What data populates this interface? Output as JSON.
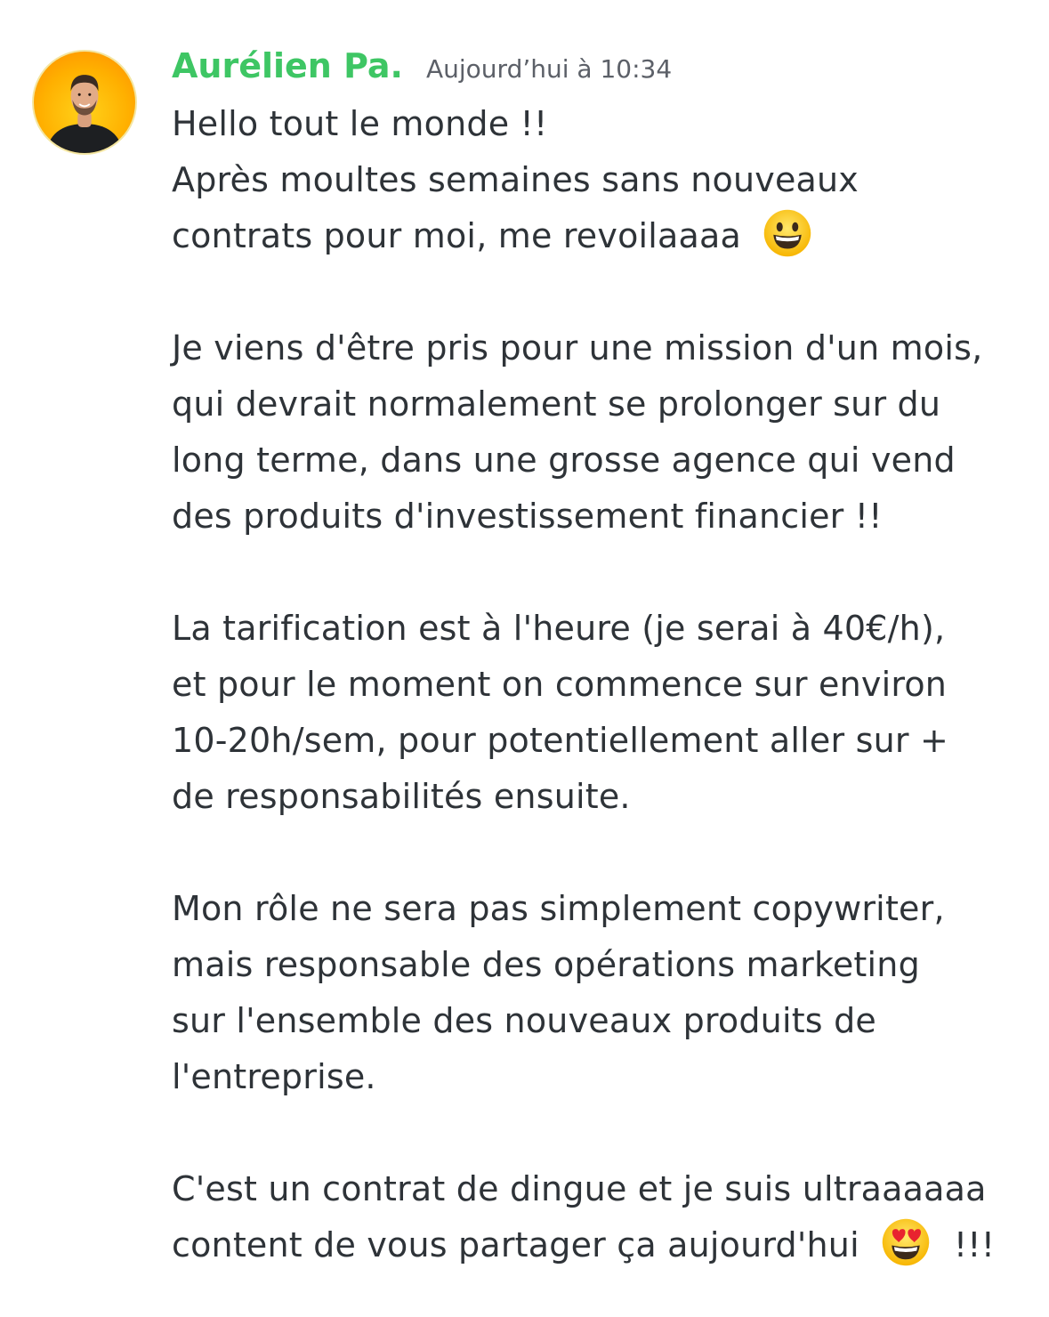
{
  "message": {
    "author": "Aurélien Pa.",
    "timestamp": "Aujourd’hui à 10:34",
    "colors": {
      "author": "#3ec664",
      "text": "#2e3338",
      "timestamp": "#5c6068",
      "avatar_bg": "#ffb000"
    },
    "avatar_icon": "user-avatar-photo",
    "lines": {
      "l1": "Hello tout le monde !!",
      "l2": "Après moultes semaines sans nouveaux",
      "l3": "contrats pour moi, me revoilaaaa",
      "l4": "Je viens d'être pris pour une mission d'un mois,",
      "l5": "qui devrait normalement se prolonger sur du",
      "l6": "long terme, dans une grosse agence qui vend",
      "l7": "des produits d'investissement financier !!",
      "l8": "La tarification est à l'heure (je serai à 40€/h),",
      "l9": "et pour le moment on commence sur environ",
      "l10": "10-20h/sem, pour potentiellement aller sur +",
      "l11": "de responsabilités ensuite.",
      "l12": "Mon rôle ne sera pas simplement copywriter,",
      "l13": "mais responsable des opérations marketing",
      "l14": "sur l'ensemble des nouveaux produits de",
      "l15": "l'entreprise.",
      "l16": "C'est un contrat de dingue et je suis ultraaaaaa",
      "l17a": "content de vous partager ça aujourd'hui",
      "l17b": "!!!"
    },
    "emojis": {
      "grinning": "grinning-face-emoji",
      "heart_eyes": "heart-eyes-emoji"
    }
  }
}
